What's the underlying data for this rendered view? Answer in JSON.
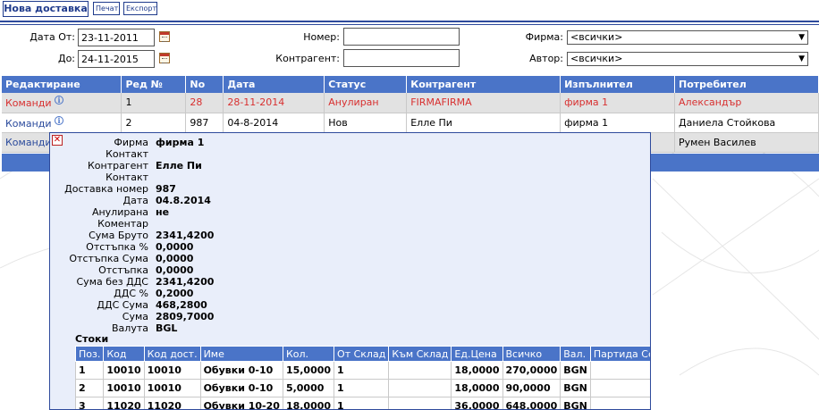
{
  "toolbar": {
    "new_delivery": "Нова доставка",
    "print": "Печат",
    "export": "Експорт"
  },
  "filters": {
    "date_from_label": "Дата От:",
    "date_from": "23-11-2011",
    "date_to_label": "До:",
    "date_to": "24-11-2015",
    "number_label": "Номер:",
    "number": "",
    "counterparty_label": "Контрагент:",
    "counterparty": "",
    "firm_label": "Фирма:",
    "firm": "<всички>",
    "author_label": "Автор:",
    "author": "<всички>"
  },
  "grid": {
    "headers": [
      "Редактиране",
      "Ред №",
      "No",
      "Дата",
      "Статус",
      "Контрагент",
      "Изпълнител",
      "Потребител"
    ],
    "rows": [
      {
        "cmd": "Команди",
        "row_no": "1",
        "no": "28",
        "date": "28-11-2014",
        "status": "Анулиран",
        "counterparty": "FIRMAFIRMA",
        "executor": "фирма 1",
        "user": "Александър"
      },
      {
        "cmd": "Команди",
        "row_no": "2",
        "no": "987",
        "date": "04-8-2014",
        "status": "Нов",
        "counterparty": "Елле Пи",
        "executor": "фирма 1",
        "user": "Даниела Стойкова"
      },
      {
        "cmd": "Команди",
        "user": "Румен Василев"
      }
    ]
  },
  "popup": {
    "details": [
      {
        "label": "Фирма",
        "value": "фирма 1"
      },
      {
        "label": "Контакт",
        "value": ""
      },
      {
        "label": "Контрагент",
        "value": "Елле Пи"
      },
      {
        "label": "Контакт",
        "value": ""
      },
      {
        "label": "Доставка номер",
        "value": "987"
      },
      {
        "label": "Дата",
        "value": "04.8.2014"
      },
      {
        "label": "Анулирана",
        "value": "не"
      },
      {
        "label": "Коментар",
        "value": ""
      },
      {
        "label": "Сума Бруто",
        "value": "2341,4200"
      },
      {
        "label": "Отстъпка %",
        "value": "0,0000"
      },
      {
        "label": "Отстъпка Сума",
        "value": "0,0000"
      },
      {
        "label": "Отстъпка",
        "value": "0,0000"
      },
      {
        "label": "Сума без ДДС",
        "value": "2341,4200"
      },
      {
        "label": "ДДС %",
        "value": "0,2000"
      },
      {
        "label": "ДДС Сума",
        "value": "468,2800"
      },
      {
        "label": "Сума",
        "value": "2809,7000"
      },
      {
        "label": "Валута",
        "value": "BGL"
      }
    ],
    "items_title": "Стоки",
    "items_headers": [
      "Поз.",
      "Код",
      "Код дост.",
      "Име",
      "Кол.",
      "От Склад",
      "Към Склад",
      "Ед.Цена",
      "Всичко",
      "Вал.",
      "Партида Сер.№"
    ],
    "items": [
      [
        "1",
        "10010",
        "10010",
        "Обувки 0-10",
        "15,0000",
        "1",
        "",
        "18,0000",
        "270,0000",
        "BGN",
        ""
      ],
      [
        "2",
        "10010",
        "10010",
        "Обувки 0-10",
        "5,0000",
        "1",
        "",
        "18,0000",
        "90,0000",
        "BGN",
        ""
      ],
      [
        "3",
        "11020",
        "11020",
        "Обувки 10-20",
        "18,0000",
        "1",
        "",
        "36,0000",
        "648,0000",
        "BGN",
        ""
      ]
    ]
  },
  "colors": {
    "header_blue": "#4a74c8",
    "nav_blue": "#1f3b8c",
    "cancelled_red": "#d83030",
    "popup_bg": "#e9eefa"
  },
  "icons": {
    "calendar": "calendar-icon",
    "info": "info-icon",
    "close": "close-icon"
  }
}
